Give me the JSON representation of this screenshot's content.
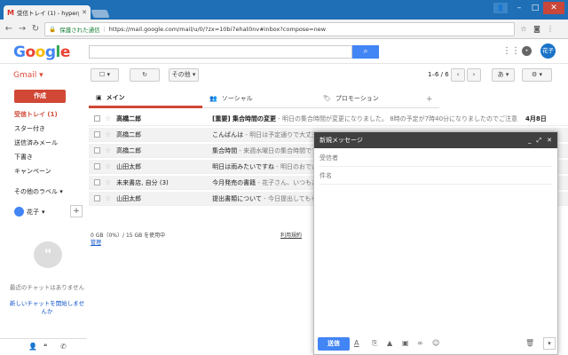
{
  "browser": {
    "tab_title": "受信トレイ (1) - hyperpra",
    "tab_favicon": "M",
    "secure_label": "保護された通信",
    "url": "https://mail.google.com/mail/u/0/?zx=10bi7ehat0nv#inbox?compose=new"
  },
  "header": {
    "logo": [
      "G",
      "o",
      "o",
      "g",
      "l",
      "e"
    ],
    "avatar_text": "花子"
  },
  "toolbar": {
    "gmail_label": "Gmail",
    "more_label": "その他",
    "pager": "1–6 / 6",
    "lang_label": "あ"
  },
  "sidebar": {
    "compose_label": "作成",
    "items": [
      {
        "label": "受信トレイ (1)",
        "active": true
      },
      {
        "label": "スター付き"
      },
      {
        "label": "送信済みメール"
      },
      {
        "label": "下書き"
      },
      {
        "label": "キャンペーン"
      }
    ],
    "other_labels": "その他のラベル",
    "hangout_user": "花子",
    "no_chat": "最近のチャットはありません",
    "start_chat": "新しいチャットを開始しませんか"
  },
  "tabs": [
    {
      "label": "メイン"
    },
    {
      "label": "ソーシャル"
    },
    {
      "label": "プロモーション"
    }
  ],
  "emails": [
    {
      "sender": "高橋二郎",
      "subject": "[重要] 集合時間の変更",
      "snippet": " - 明日の集合時間が変更になりました。 8時の予定が7時40分になりましたのでご注意",
      "date": "4月8日",
      "unread": true
    },
    {
      "sender": "高橋二郎",
      "subject": "こんばんは",
      "snippet": " - 明日は予定通りで大丈夫",
      "date": "",
      "unread": false
    },
    {
      "sender": "高橋二郎",
      "subject": "集合時間",
      "snippet": " - 来週水曜日の集合時間です",
      "date": "",
      "unread": false
    },
    {
      "sender": "山田太郎",
      "subject": "明日は雨みたいですね",
      "snippet": " - 明日のおでか",
      "date": "",
      "unread": false
    },
    {
      "sender": "未来書店, 自分 (3)",
      "subject": "今月発売の書籍",
      "snippet": " - 花子さん、いつもあ",
      "date": "",
      "unread": false
    },
    {
      "sender": "山田太郎",
      "subject": "提出書類について",
      "snippet": " - 今日提出してもら",
      "date": "",
      "unread": false
    }
  ],
  "footer": {
    "storage": "0 GB（0%）/ 15 GB を使用中",
    "manage": "管理",
    "terms": "利用規約"
  },
  "compose": {
    "title": "新規メッセージ",
    "to_placeholder": "受信者",
    "subject_placeholder": "件名",
    "send_label": "送信"
  }
}
